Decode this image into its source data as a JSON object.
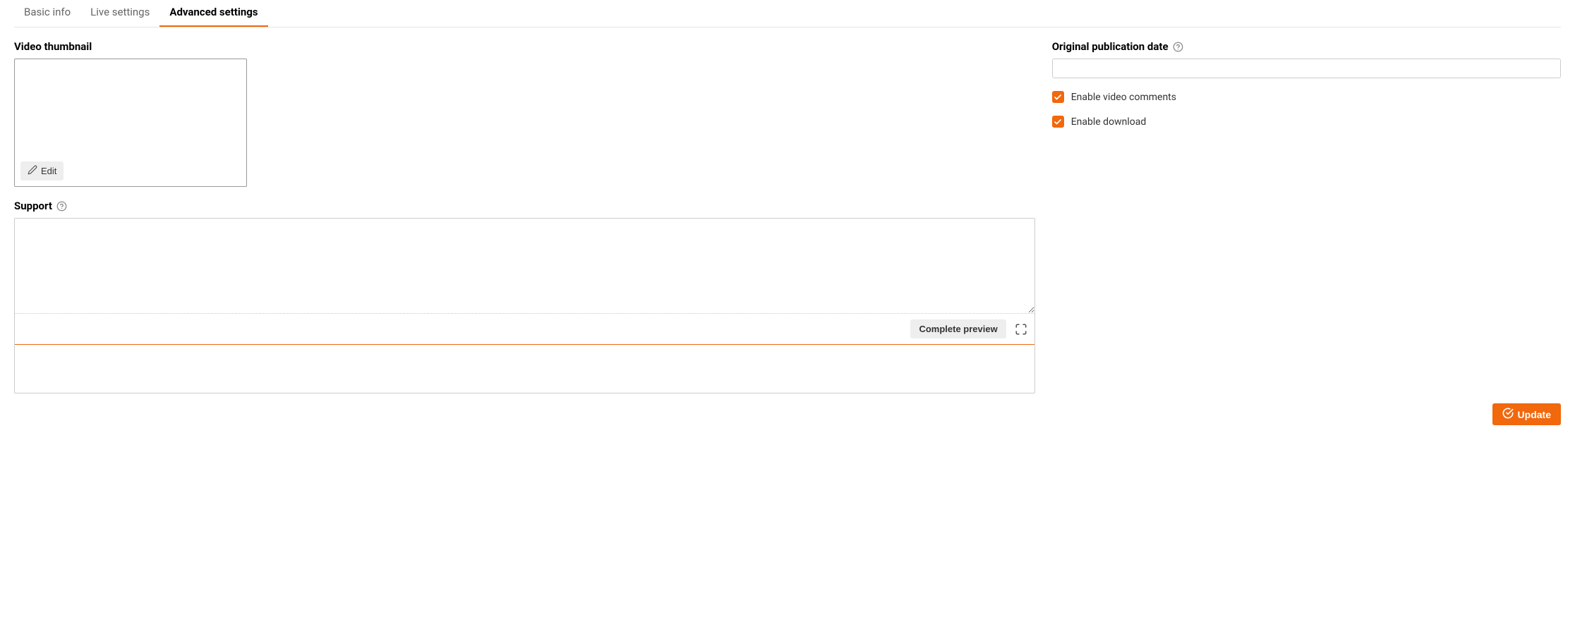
{
  "tabs": {
    "basic_info": "Basic info",
    "live_settings": "Live settings",
    "advanced_settings": "Advanced settings"
  },
  "left": {
    "thumbnail_label": "Video thumbnail",
    "edit_label": "Edit",
    "support_label": "Support",
    "support_value": "",
    "complete_preview_label": "Complete preview"
  },
  "right": {
    "pub_date_label": "Original publication date",
    "pub_date_value": "",
    "enable_comments_label": "Enable video comments",
    "enable_download_label": "Enable download"
  },
  "footer": {
    "update_label": "Update"
  }
}
